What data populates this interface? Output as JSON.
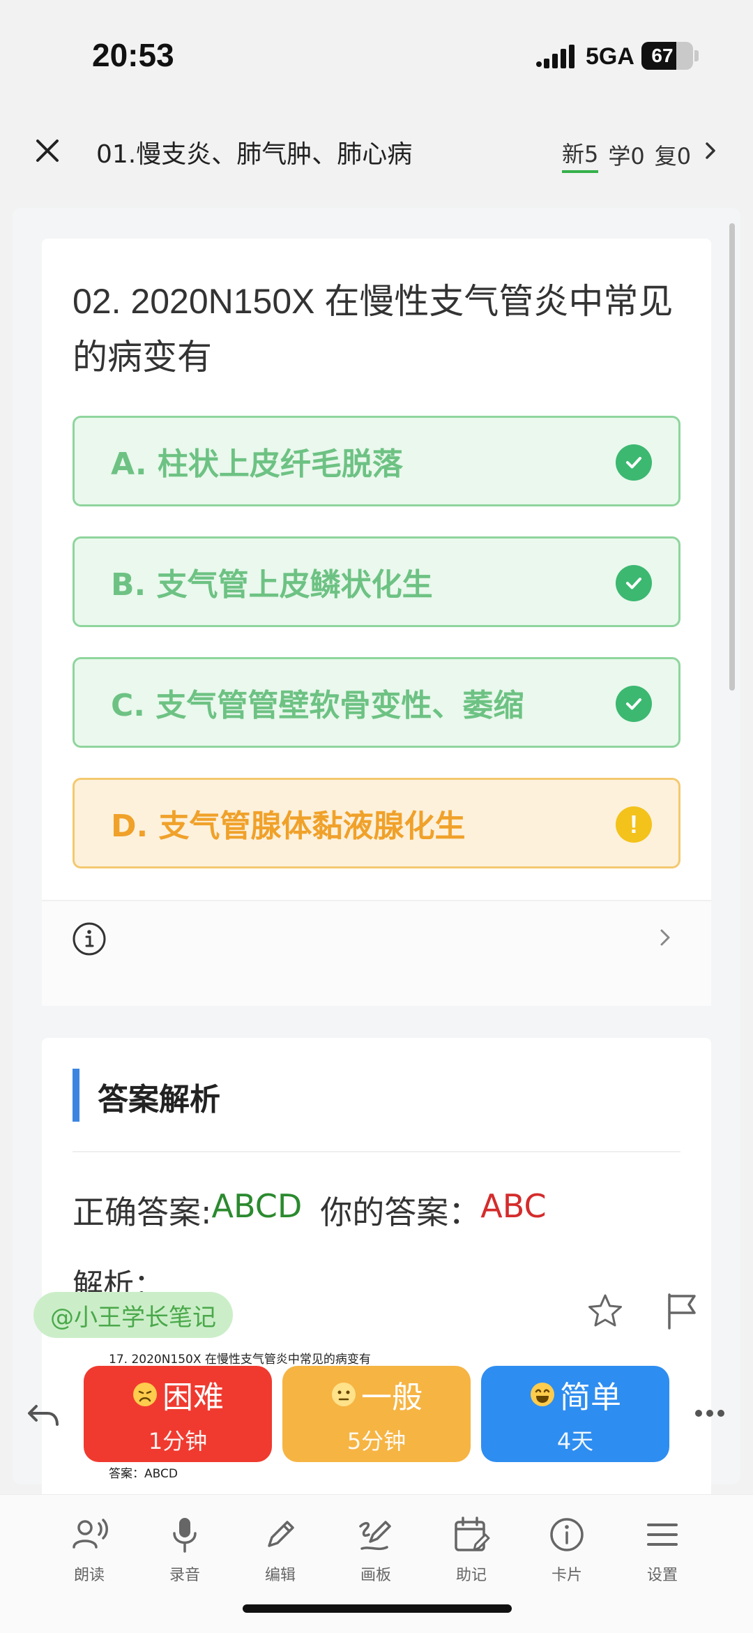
{
  "status_bar": {
    "time": "20:53",
    "network": "5GA",
    "battery": "67",
    "battery_level": 0.67
  },
  "nav": {
    "title": "01.慢支炎、肺气肿、肺心病",
    "stats": {
      "new": "新5",
      "learn": "学0",
      "review": "复0"
    }
  },
  "question": {
    "title": "02. 2020N150X 在慢性支气管炎中常见的病变有",
    "options": [
      {
        "label": "A. 柱状上皮纤毛脱落",
        "state": "correct",
        "icon": "check-icon"
      },
      {
        "label": "B. 支气管上皮鳞状化生",
        "state": "correct",
        "icon": "check-icon"
      },
      {
        "label": "C. 支气管管壁软骨变性、萎缩",
        "state": "correct",
        "icon": "check-icon"
      },
      {
        "label": "D. 支气管腺体黏液腺化生",
        "state": "missed",
        "icon": "exclamation-icon",
        "icon_text": "!"
      }
    ]
  },
  "answer": {
    "section_title": "答案解析",
    "correct_label": "正确答案: ",
    "correct_value": "ABCD",
    "yours_label": "你的答案：",
    "yours_value": "ABC",
    "explain_label": "解析："
  },
  "watermark": "@小王学长笔记",
  "snippet": {
    "question": "17.  2020N150X  在慢性支气管炎中常见的病变有",
    "answer": "答案：ABCD"
  },
  "rating": {
    "hard": {
      "label": "困难",
      "time": "1分钟"
    },
    "normal": {
      "label": "一般",
      "time": "5分钟"
    },
    "easy": {
      "label": "简单",
      "time": "4天"
    }
  },
  "toolbar": [
    {
      "label": "朗读",
      "icon": "read-aloud-icon"
    },
    {
      "label": "录音",
      "icon": "microphone-icon"
    },
    {
      "label": "编辑",
      "icon": "pencil-icon"
    },
    {
      "label": "画板",
      "icon": "drawing-board-icon"
    },
    {
      "label": "助记",
      "icon": "calendar-edit-icon"
    },
    {
      "label": "卡片",
      "icon": "info-icon"
    },
    {
      "label": "设置",
      "icon": "menu-icon"
    }
  ],
  "colors": {
    "correct": "#3cb871",
    "missed": "#f3c21b",
    "hard": "#f03a2f",
    "normal": "#f6b443",
    "easy": "#2e8df0",
    "accent": "#3d86e0"
  }
}
